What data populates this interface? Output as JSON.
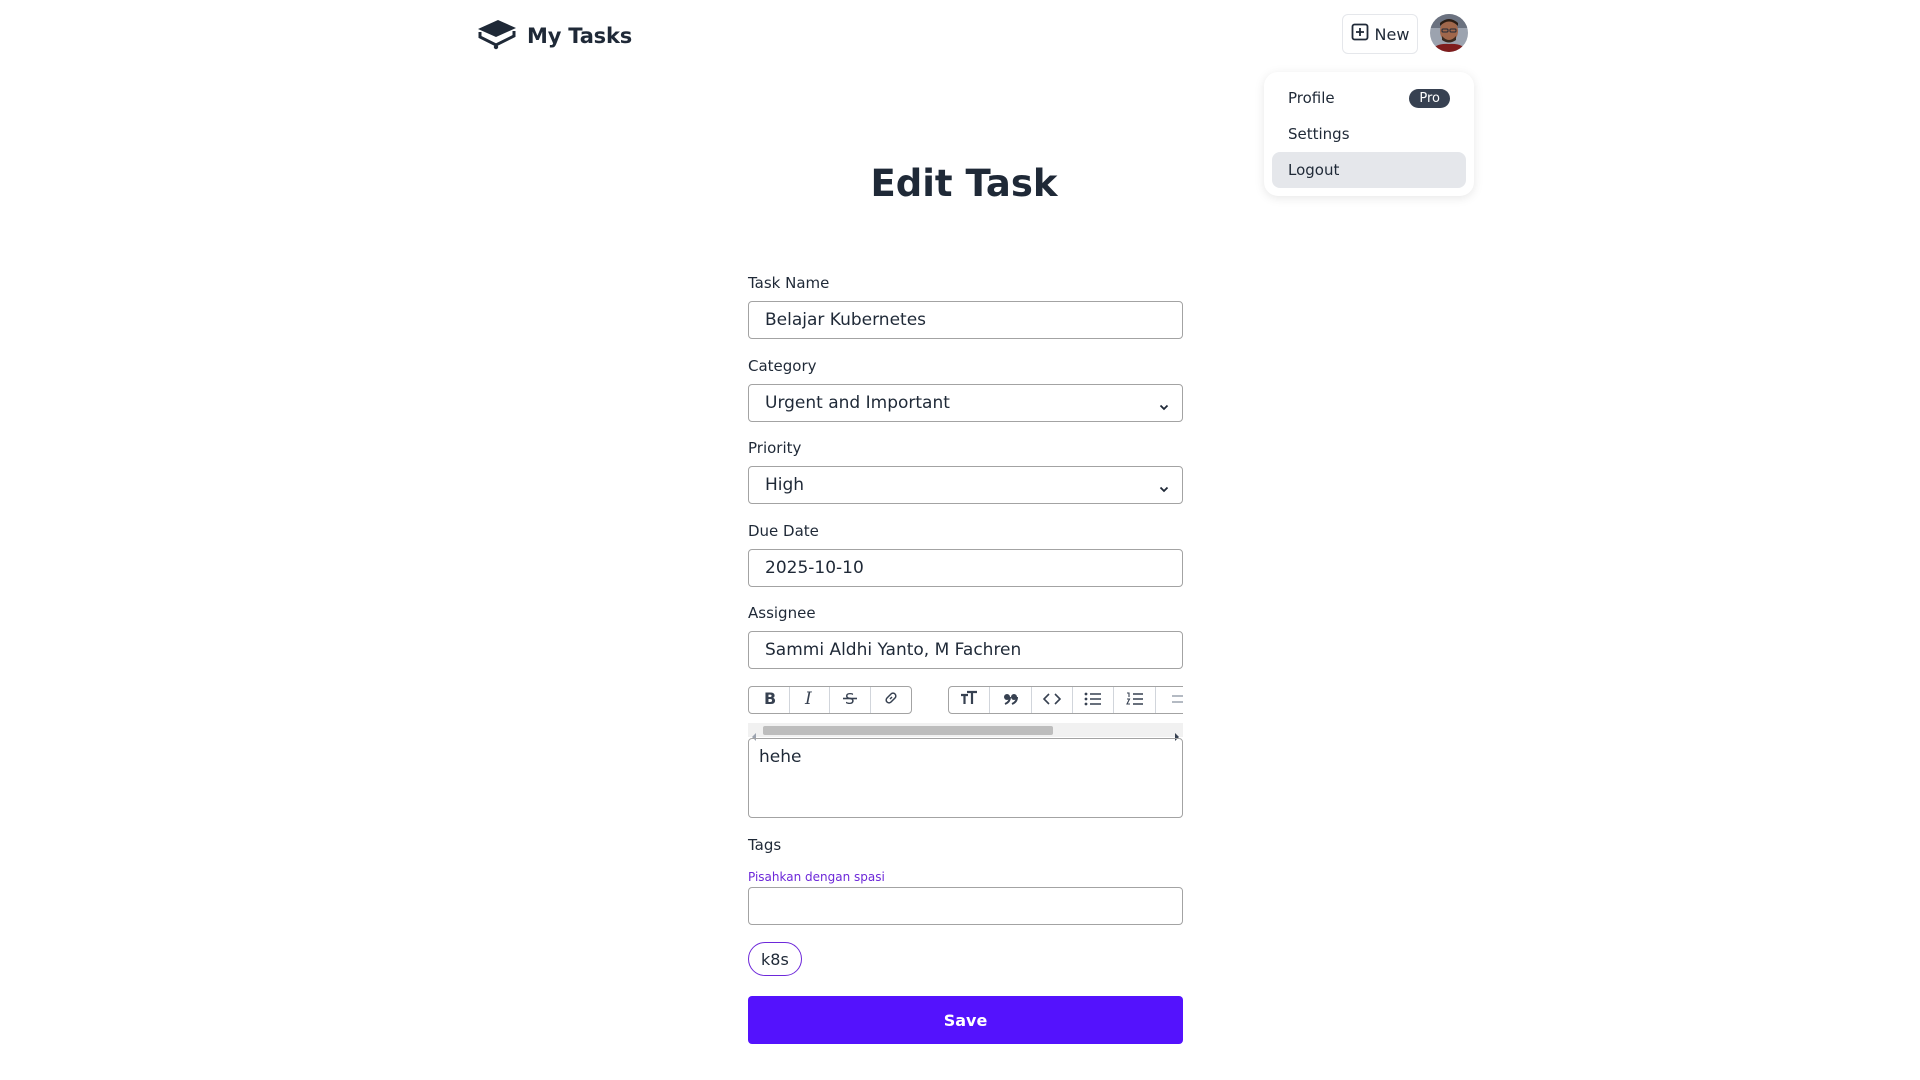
{
  "app": {
    "name": "My Tasks"
  },
  "header": {
    "new_label": "New"
  },
  "menu": {
    "items": [
      {
        "label": "Profile",
        "badge": "Pro"
      },
      {
        "label": "Settings"
      },
      {
        "label": "Logout"
      }
    ]
  },
  "page": {
    "title": "Edit Task"
  },
  "form": {
    "task_name": {
      "label": "Task Name",
      "value": "Belajar Kubernetes"
    },
    "category": {
      "label": "Category",
      "value": "Urgent and Important"
    },
    "priority": {
      "label": "Priority",
      "value": "High"
    },
    "due_date": {
      "label": "Due Date",
      "value": "2025-10-10"
    },
    "assignee": {
      "label": "Assignee",
      "value": "Sammi Aldhi Yanto, M Fachren"
    },
    "description": {
      "value": "hehe"
    },
    "tags": {
      "label": "Tags",
      "hint": "Pisahkan dengan spasi",
      "value": "",
      "chips": [
        "k8s"
      ]
    },
    "save_label": "Save"
  },
  "colors": {
    "primary": "#5412fd",
    "hint": "#6d28d9",
    "text": "#1f2937"
  },
  "icons": [
    "book-logo-icon",
    "plus-square-icon",
    "chevron-down-icon",
    "bold-icon",
    "italic-icon",
    "strikethrough-icon",
    "link-icon",
    "heading-icon",
    "quote-icon",
    "code-icon",
    "bullet-list-icon",
    "numbered-list-icon",
    "checklist-icon"
  ]
}
